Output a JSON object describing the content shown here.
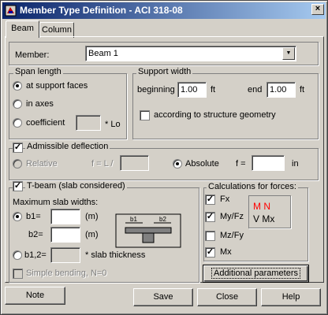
{
  "window": {
    "title": "Member Type Definition - ACI 318-08",
    "close_label": "×"
  },
  "tabs": [
    {
      "label": "Beam"
    },
    {
      "label": "Column"
    }
  ],
  "member": {
    "label": "Member:",
    "value": "Beam 1"
  },
  "span_length": {
    "title": "Span length",
    "options": [
      "at support faces",
      "in axes",
      "coefficient"
    ],
    "selected": "at support faces",
    "coefficient_suffix": "* Lo"
  },
  "support_width": {
    "title": "Support width",
    "beginning_label": "beginning",
    "beginning_value": "1.00",
    "beginning_unit": "ft",
    "end_label": "end",
    "end_value": "1.00",
    "end_unit": "ft",
    "geometry_label": "according to structure geometry"
  },
  "deflection": {
    "title": "Admissible deflection",
    "checked": true,
    "relative_label": "Relative",
    "relative_formula": "f = L /",
    "absolute_label": "Absolute",
    "f_label": "f =",
    "unit": "in"
  },
  "tbeam": {
    "title": "T-beam (slab considered)",
    "checked": true,
    "widths_label": "Maximum slab widths:",
    "b1_label": "b1=",
    "b2_label": "b2=",
    "unit": "(m)",
    "b12_label": "b1,2=",
    "thickness_label": "* slab thickness",
    "simple_bending_label": "Simple bending, N=0",
    "diagram_b1": "b1",
    "diagram_b2": "b2"
  },
  "forces": {
    "title": "Calculations for forces:",
    "items": [
      {
        "label": "Fx",
        "checked": true
      },
      {
        "label": "My/Fz",
        "checked": true
      },
      {
        "label": "Mz/Fy",
        "checked": false
      },
      {
        "label": "Mx",
        "checked": true
      }
    ],
    "legend_line1": "M N",
    "legend_line2": "V Mx",
    "legend_color": "#ff0000"
  },
  "buttons": {
    "additional": "Additional parameters",
    "note": "Note",
    "save": "Save",
    "close": "Close",
    "help": "Help"
  }
}
